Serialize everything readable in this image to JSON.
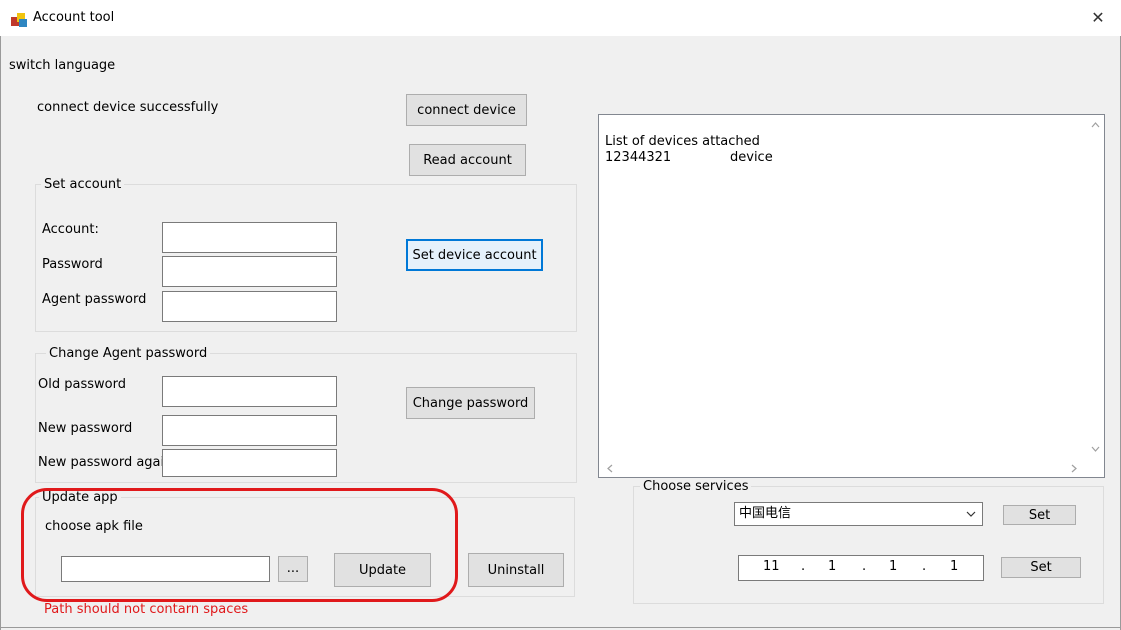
{
  "window": {
    "title": "Account tool",
    "close_glyph": "✕"
  },
  "top": {
    "switch_language": "switch language",
    "status": "connect device successfully",
    "connect_button": "connect device",
    "read_button": "Read account"
  },
  "set_account": {
    "legend": "Set account",
    "account_label": "Account:",
    "account_value": "",
    "password_label": "Password",
    "password_value": "",
    "agent_password_label": "Agent password",
    "agent_password_value": "",
    "set_button": "Set device account"
  },
  "change_agent": {
    "legend": "Change Agent password",
    "old_label": "Old password",
    "new_label": "New password",
    "again_label": "New password again",
    "change_button": "Change password"
  },
  "update_app": {
    "legend": "Update app",
    "choose_label": "choose apk file",
    "path_value": "",
    "browse_button": "...",
    "update_button": "Update",
    "uninstall_button": "Uninstall",
    "warning": "Path should not contarn spaces",
    "warning_color": "#e0191b"
  },
  "device_log": {
    "line1": "List of devices attached",
    "device_id": "12344321",
    "device_state": "device"
  },
  "services": {
    "legend": "Choose services",
    "selected": "中国电信",
    "set_button": "Set",
    "ip": [
      "11",
      "1",
      "1",
      "1"
    ],
    "ip_set_button": "Set"
  },
  "accent": "#0078d7"
}
